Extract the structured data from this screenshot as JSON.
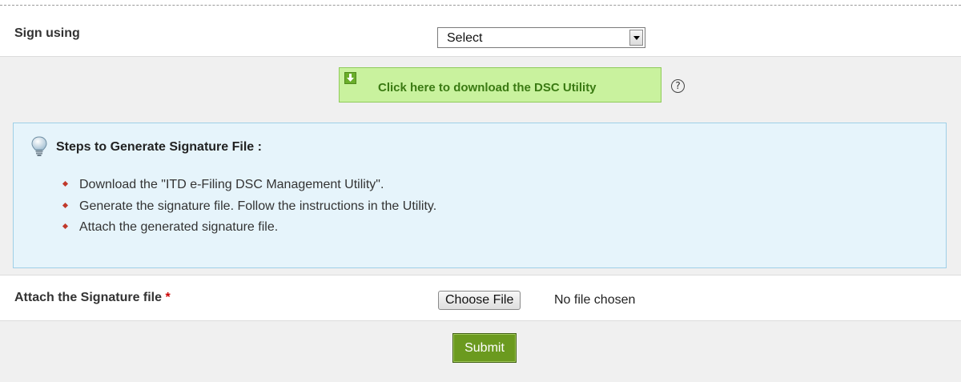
{
  "sign_using": {
    "label": "Sign using",
    "select_value": "Select"
  },
  "download": {
    "button_label": "Click here to download the DSC Utility",
    "help_glyph": "?"
  },
  "steps": {
    "title": "Steps to Generate Signature File :",
    "items": [
      "Download the \"ITD e-Filing DSC Management Utility\".",
      "Generate the signature file. Follow the instructions in the Utility.",
      "Attach the generated signature file."
    ]
  },
  "attach": {
    "label": "Attach the Signature file",
    "required_marker": "*",
    "choose_button": "Choose File",
    "status": "No file chosen"
  },
  "submit": {
    "label": "Submit"
  },
  "colors": {
    "download_bg": "#c9f29e",
    "steps_bg": "#e6f4fb",
    "submit_bg": "#6b9a1f",
    "bullet": "#c0392b"
  },
  "icons": {
    "download": "download-arrow-icon",
    "help": "question-circle-icon",
    "tip": "lightbulb-icon",
    "select_arrow": "chevron-down-icon"
  }
}
